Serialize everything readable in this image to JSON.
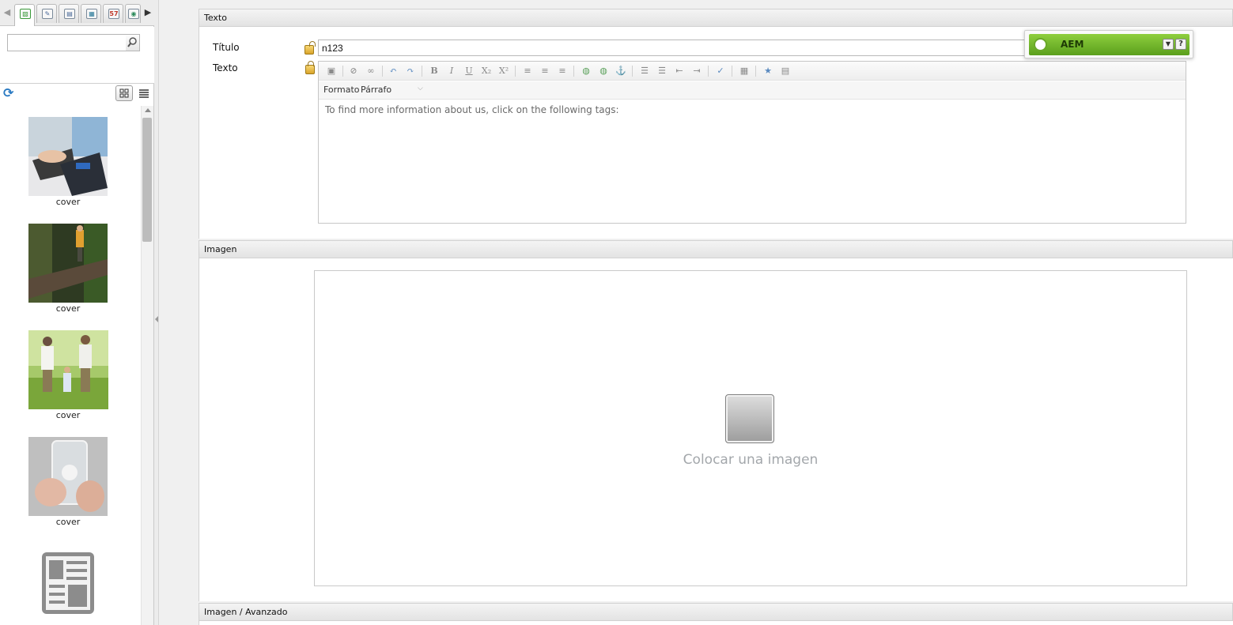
{
  "sidebar": {
    "tabs": [
      {
        "icon": "images-tab-icon",
        "glyph": "▧",
        "color": "#3a9a3a"
      },
      {
        "icon": "documents-tab-icon",
        "glyph": "✎",
        "color": "#4a6a9a"
      },
      {
        "icon": "pages-tab-icon",
        "glyph": "▤",
        "color": "#4a6a9a"
      },
      {
        "icon": "movies-tab-icon",
        "glyph": "▦",
        "color": "#2a7a9a"
      },
      {
        "icon": "calendar-tab-icon",
        "glyph": "57",
        "color": "#c03a2b"
      },
      {
        "icon": "paragraphs-tab-icon",
        "glyph": "◉",
        "color": "#2a8a5a"
      }
    ],
    "search": {
      "value": "",
      "placeholder": ""
    },
    "assets": [
      {
        "label": "cover",
        "kind": "laptop-photo"
      },
      {
        "label": "cover",
        "kind": "forest-photo"
      },
      {
        "label": "cover",
        "kind": "family-photo"
      },
      {
        "label": "cover",
        "kind": "phone-photo"
      },
      {
        "label": "",
        "kind": "document-icon"
      }
    ]
  },
  "text_panel": {
    "header": "Texto",
    "title_label": "Título",
    "title_value": "n123",
    "text_label": "Texto",
    "format_label": "Formato",
    "format_value": "Párrafo",
    "content": "To find more information about us, click on the following tags:"
  },
  "image_panel": {
    "header": "Imagen",
    "placeholder": "Colocar una imagen"
  },
  "advanced_panel": {
    "header": "Imagen / Avanzado"
  },
  "aem": {
    "title": "AEM",
    "accent": "#6fb32d"
  }
}
